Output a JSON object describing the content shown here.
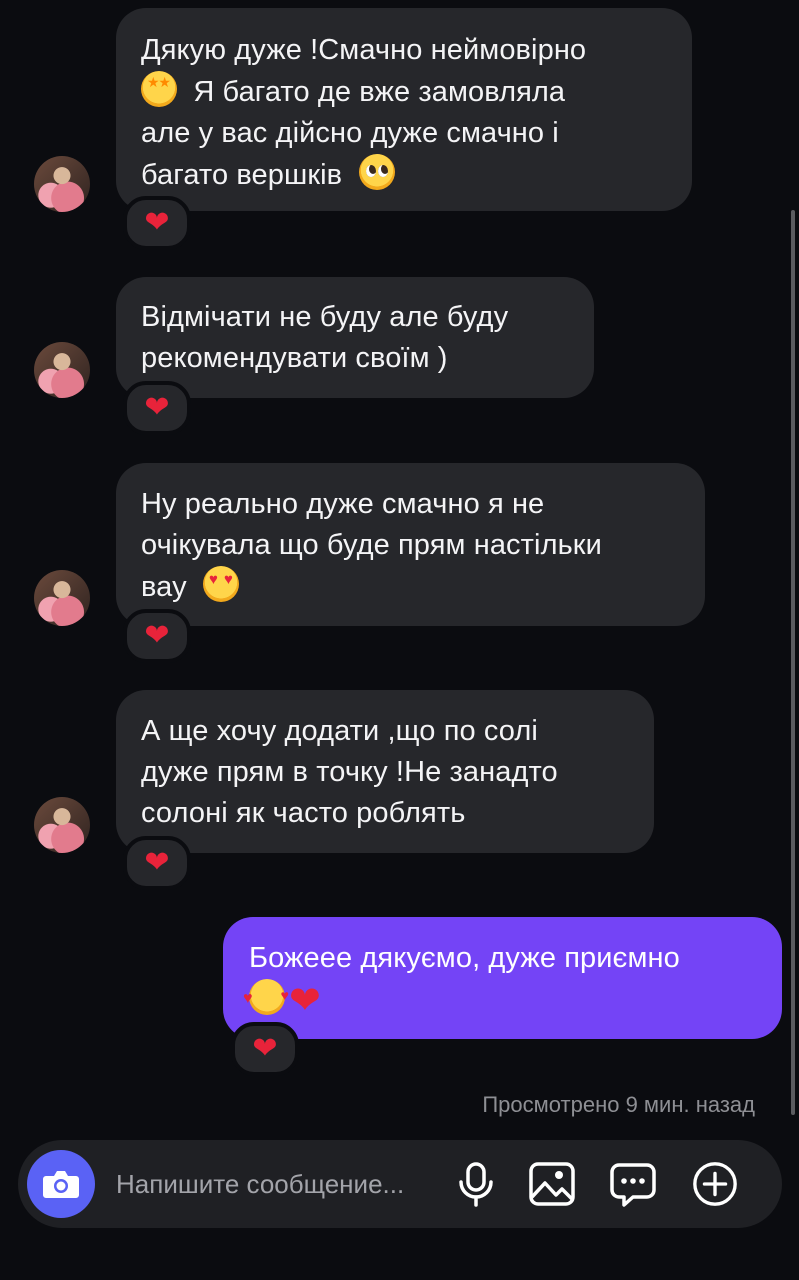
{
  "messages": [
    {
      "direction": "incoming",
      "lines": [
        "Дякую дуже !Смачно неймовірно",
        "Я багато де вже замовляла",
        "але у вас дійсно дуже смачно і",
        "багато вершків"
      ],
      "emojis": [
        "star-struck-emoji",
        "pleading-face-emoji"
      ],
      "reaction": "❤"
    },
    {
      "direction": "incoming",
      "lines": [
        "Відмічати не буду але буду",
        "рекомендувати своїм )"
      ],
      "reaction": "❤"
    },
    {
      "direction": "incoming",
      "lines": [
        "Ну реально дуже смачно я не",
        "очікувала що буде прям настільки",
        "вау"
      ],
      "emojis": [
        "heart-eyes-emoji"
      ],
      "reaction": "❤"
    },
    {
      "direction": "incoming",
      "lines": [
        "А ще хочу додати ,що по солі",
        "дуже прям в точку !Не занадто",
        "солоні як часто роблять"
      ],
      "reaction": "❤"
    },
    {
      "direction": "outgoing",
      "lines": [
        "Божеее дякуємо, дуже приємно"
      ],
      "emojis": [
        "smiling-face-with-hearts-emoji",
        "red-heart-emoji"
      ],
      "inline_heart": "❤",
      "reaction": "❤"
    }
  ],
  "status": {
    "seen_text": "Просмотрено 9 мин. назад"
  },
  "composer": {
    "placeholder": "Напишите сообщение..."
  },
  "icons": {
    "camera": "camera-icon",
    "mic": "microphone-icon",
    "gallery": "image-icon",
    "sticker": "chat-bubble-icon",
    "plus": "plus-circle-icon"
  },
  "colors": {
    "background": "#0b0c10",
    "incoming_bubble": "#26272b",
    "outgoing_bubble": "#7444f6",
    "reaction_heart": "#e8233a",
    "camera_button": "#5a62f5"
  }
}
